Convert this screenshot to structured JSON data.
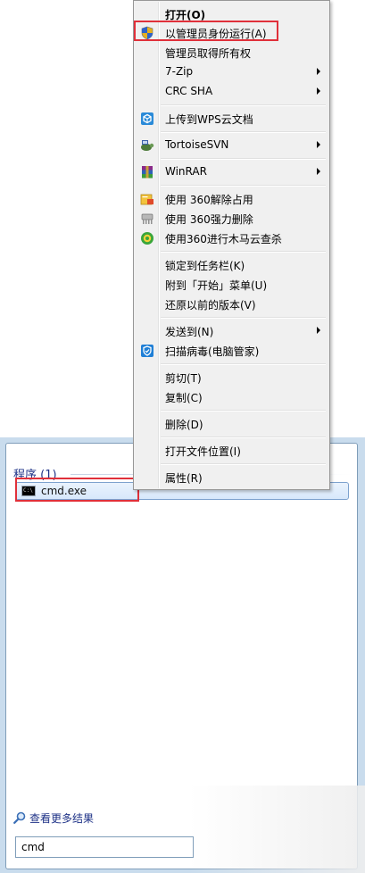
{
  "start_menu": {
    "section_title": "程序 (1)",
    "result": {
      "label": "cmd.exe",
      "icon": "cmd-console-icon",
      "icon_text": "C:\\"
    },
    "more_results_label": "查看更多结果",
    "search_value": "cmd"
  },
  "context_menu": {
    "items": [
      {
        "label": "打开(O)",
        "bold": true
      },
      {
        "label": "以管理员身份运行(A)",
        "icon": "uac-shield-icon"
      },
      {
        "label": "管理员取得所有权"
      },
      {
        "label": "7-Zip",
        "submenu": true
      },
      {
        "label": "CRC SHA",
        "submenu": true
      },
      {
        "label": "上传到WPS云文档",
        "icon": "wps-cloud-icon"
      },
      {
        "label": "TortoiseSVN",
        "submenu": true,
        "icon": "tortoisesvn-icon"
      },
      {
        "label": "WinRAR",
        "submenu": true,
        "icon": "winrar-icon"
      },
      {
        "label": "使用 360解除占用",
        "icon": "360-unlock-icon"
      },
      {
        "label": "使用 360强力删除",
        "icon": "360-shred-icon"
      },
      {
        "label": "使用360进行木马云查杀",
        "icon": "360-scan-icon"
      },
      {
        "label": "锁定到任务栏(K)"
      },
      {
        "label": "附到「开始」菜单(U)"
      },
      {
        "label": "还原以前的版本(V)"
      },
      {
        "label": "发送到(N)",
        "submenu": true
      },
      {
        "label": "扫描病毒(电脑管家)",
        "icon": "pc-manager-shield-icon"
      },
      {
        "label": "剪切(T)"
      },
      {
        "label": "复制(C)"
      },
      {
        "label": "删除(D)"
      },
      {
        "label": "打开文件位置(I)"
      },
      {
        "label": "属性(R)"
      }
    ]
  },
  "colors": {
    "highlight_box": "#e0303a",
    "link_blue": "#1e3287",
    "menu_bg": "#f0f0f0"
  }
}
